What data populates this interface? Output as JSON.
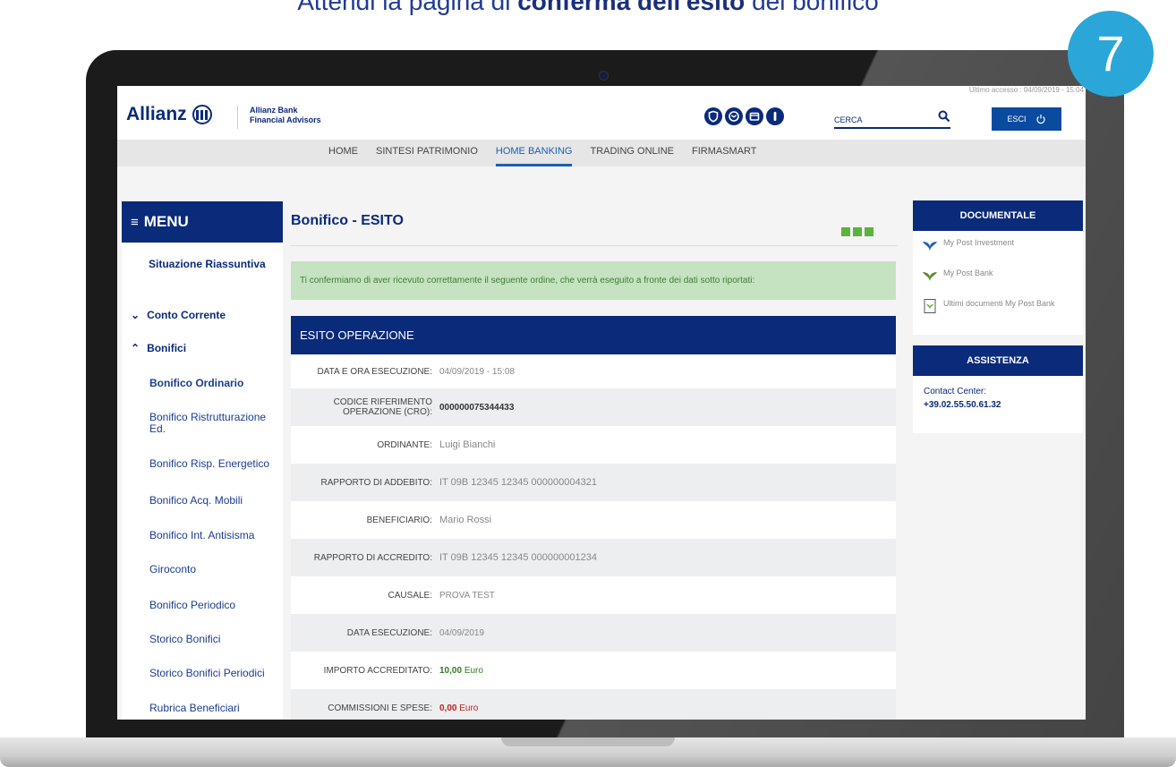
{
  "caption": {
    "prefix": "Attendi la pagina di ",
    "highlight": "conferma dell'esito",
    "suffix": " del bonifico"
  },
  "step_number": "7",
  "header": {
    "last_access": "Ultimo accesso : 04/09/2019 - 15:04",
    "logo_text": "Allianz",
    "bank_name_line1": "Allianz Bank",
    "bank_name_line2": "Financial Advisors",
    "icons": [
      "shield-icon",
      "mail-icon",
      "folder-icon",
      "info-icon"
    ],
    "search_placeholder": "CERCA",
    "logout_label": "ESCI"
  },
  "nav": {
    "items": [
      "HOME",
      "SINTESI PATRIMONIO",
      "HOME BANKING",
      "TRADING ONLINE",
      "FIRMASMART"
    ],
    "active": "HOME BANKING"
  },
  "sidebar": {
    "menu_label": "MENU",
    "situazione": "Situazione Riassuntiva",
    "conto_corrente": "Conto Corrente",
    "bonifici": "Bonifici",
    "sub_items": [
      "Bonifico Ordinario",
      "Bonifico Ristrutturazione Ed.",
      "Bonifico Risp. Energetico",
      "Bonifico Acq. Mobili",
      "Bonifico Int. Antisisma",
      "Giroconto",
      "Bonifico Periodico",
      "Storico Bonifici",
      "Storico Bonifici Periodici",
      "Rubrica Beneficiari"
    ]
  },
  "main": {
    "title": "Bonifico - ESITO",
    "confirm_message": "Ti confermiamo di aver ricevuto correttamente il seguente ordine, che verrà eseguito a fronte dei dati sotto riportati:",
    "section_title": "ESITO OPERAZIONE",
    "rows": [
      {
        "label": "DATA E ORA ESECUZIONE:",
        "value": "04/09/2019 - 15:08"
      },
      {
        "label": "CODICE RIFERIMENTO OPERAZIONE (CRO):",
        "value": "000000075344433"
      },
      {
        "label": "ORDINANTE:",
        "value": "Luigi Bianchi"
      },
      {
        "label": "RAPPORTO DI ADDEBITO:",
        "value": "IT 09B 12345 12345 000000004321"
      },
      {
        "label": "BENEFICIARIO:",
        "value": "Mario Rossi"
      },
      {
        "label": "RAPPORTO DI ACCREDITO:",
        "value": "IT 09B 12345 12345 000000001234"
      },
      {
        "label": "CAUSALE:",
        "value": "PROVA TEST"
      },
      {
        "label": "DATA ESECUZIONE:",
        "value": "04/09/2019"
      },
      {
        "label": "IMPORTO ACCREDITATO:",
        "amount": "10,00",
        "currency": "Euro"
      },
      {
        "label": "COMMISSIONI E SPESE:",
        "amount": "0,00",
        "currency": "Euro"
      }
    ]
  },
  "documentale": {
    "title": "DOCUMENTALE",
    "items": [
      "My Post Investment",
      "My Post Bank",
      "Ultimi documenti My Post Bank"
    ]
  },
  "assistenza": {
    "title": "ASSISTENZA",
    "contact_label": "Contact Center:",
    "contact_number": "+39.02.55.50.61.32"
  },
  "colors": {
    "brand_blue": "#0a2a7a",
    "accent_green": "#5ab33a",
    "confirm_bg": "#c5e2c1",
    "badge": "#2aa7d8"
  }
}
